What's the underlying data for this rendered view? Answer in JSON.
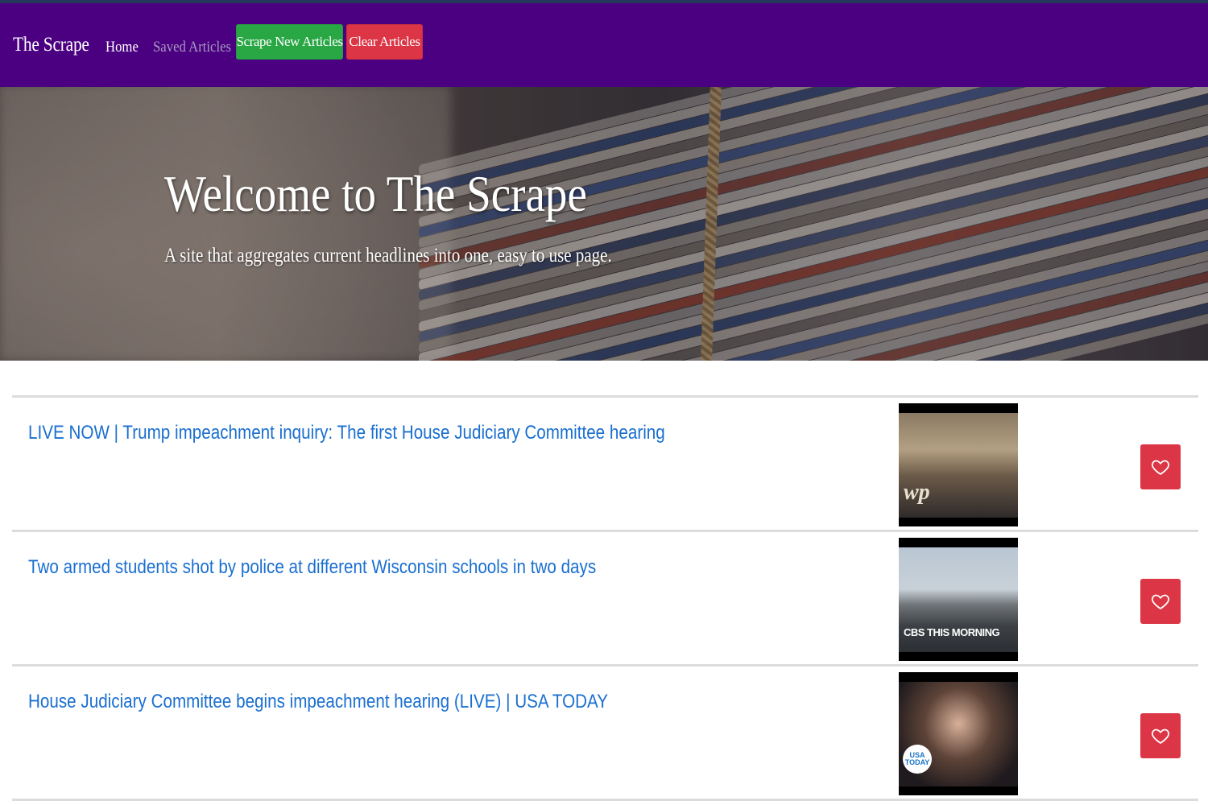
{
  "navbar": {
    "brand": "The Scrape",
    "home_label": "Home",
    "saved_label": "Saved Articles",
    "scrape_label": "Scrape New Articles",
    "clear_label": "Clear Articles",
    "background_color": "#4b0082"
  },
  "hero": {
    "title": "Welcome to The Scrape",
    "subtitle": "A site that aggregates current headlines into one, easy to use page."
  },
  "articles": [
    {
      "title": "LIVE NOW | Trump impeachment inquiry: The first House Judiciary Committee hearing",
      "thumbnail_badge": "wp",
      "favorite_icon": "heart-outline-icon"
    },
    {
      "title": "Two armed students shot by police at different Wisconsin schools in two days",
      "thumbnail_badge": "CBS THIS MORNING",
      "favorite_icon": "heart-outline-icon"
    },
    {
      "title": "House Judiciary Committee begins impeachment hearing (LIVE) | USA TODAY",
      "thumbnail_badge": "USA TODAY",
      "favorite_icon": "heart-outline-icon"
    }
  ],
  "colors": {
    "accent_link": "#1a6fd0",
    "success": "#2aa745",
    "danger": "#dc3545"
  }
}
